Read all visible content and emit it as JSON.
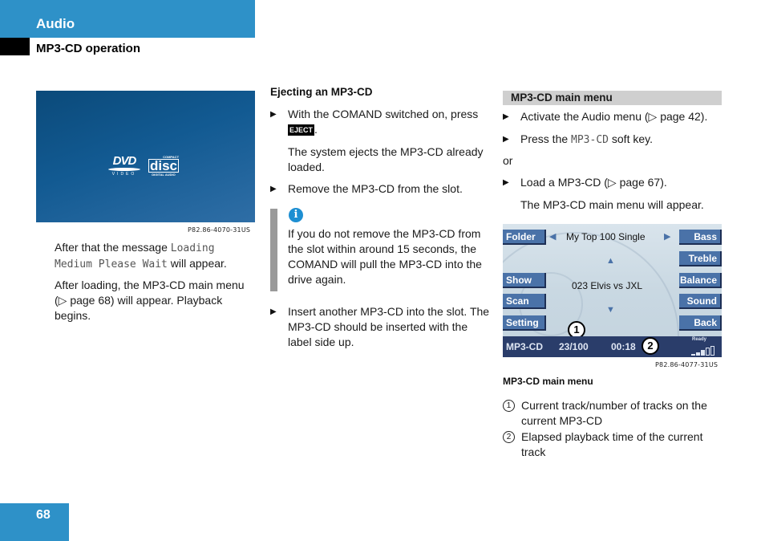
{
  "header": {
    "section": "Audio",
    "subsection": "MP3-CD operation"
  },
  "left_column": {
    "image_logos": {
      "dvd": "DVD",
      "dvd_sub": "VIDEO",
      "cd_top": "COMPACT",
      "cd_main": "disc",
      "cd_sub": "DIGITAL AUDIO"
    },
    "figure_code": "P82.86-4070-31US",
    "para1_before": "After that the message ",
    "para1_mono": "Loading Medium Please Wait",
    "para1_after": " will appear.",
    "para2": "After loading, the MP3-CD main menu (▷ page 68) will appear. Playback begins."
  },
  "middle_column": {
    "heading": "Ejecting an MP3-CD",
    "step1_text": "With the COMAND switched on, press ",
    "eject_key": "EJECT",
    "step1_end": ".",
    "step1_result": "The system ejects the MP3-CD already loaded.",
    "step2": "Remove the MP3-CD from the slot.",
    "info_icon": "i",
    "info_text": "If you do not remove the MP3-CD from the slot within around 15 seconds, the COMAND will pull the MP3-CD into the drive again.",
    "step3": "Insert another MP3-CD into the slot. The MP3-CD should be inserted with the label side up."
  },
  "right_column": {
    "heading": "MP3-CD main menu",
    "step1": "Activate the Audio menu (▷ page 42).",
    "step2_before": "Press the ",
    "step2_mono": "MP3-CD",
    "step2_after": " soft key.",
    "or": "or",
    "step3": "Load a MP3-CD (▷ page 67).",
    "step3_result": "The MP3-CD main menu will appear.",
    "screen": {
      "left_keys": [
        "Folder",
        "Show",
        "Scan",
        "Setting"
      ],
      "right_keys": [
        "Bass",
        "Treble",
        "Balance",
        "Sound",
        "Back"
      ],
      "folder_name": "My Top 100 Single",
      "track": "023 Elvis vs JXL",
      "status_source": "MP3-CD",
      "status_track": "23/100",
      "status_time": "00:18",
      "status_ready": "Ready",
      "callout1": "1",
      "callout2": "2"
    },
    "figure_code": "P82.86-4077-31US",
    "caption": "MP3-CD main menu",
    "legend": [
      {
        "num": "1",
        "text": "Current track/number of tracks on the current MP3-CD"
      },
      {
        "num": "2",
        "text": "Elapsed playback time of the current track"
      }
    ]
  },
  "footer": {
    "page_number": "68"
  }
}
